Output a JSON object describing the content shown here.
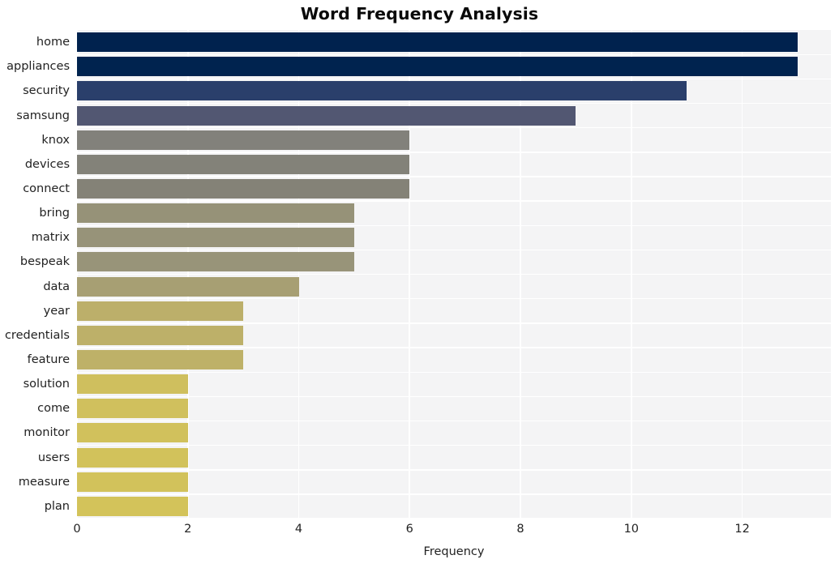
{
  "chart_data": {
    "type": "bar",
    "orientation": "horizontal",
    "title": "Word Frequency Analysis",
    "xlabel": "Frequency",
    "ylabel": "",
    "xlim": [
      0,
      13.6
    ],
    "ylim": [
      0,
      20
    ],
    "grid": true,
    "legend": null,
    "xticks": [
      0,
      2,
      4,
      6,
      8,
      10,
      12
    ],
    "xticklabels": [
      "0",
      "2",
      "4",
      "6",
      "8",
      "10",
      "12"
    ],
    "categories": [
      "home",
      "appliances",
      "security",
      "samsung",
      "knox",
      "devices",
      "connect",
      "bring",
      "matrix",
      "bespeak",
      "data",
      "year",
      "credentials",
      "feature",
      "solution",
      "come",
      "monitor",
      "users",
      "measure",
      "plan"
    ],
    "values": [
      13,
      13,
      11,
      9,
      6,
      6,
      6,
      5,
      5,
      5,
      4,
      3,
      3,
      3,
      2,
      2,
      2,
      2,
      2,
      2
    ],
    "colors": [
      "#00224e",
      "#00234f",
      "#2a3f6b",
      "#525772",
      "#82817b",
      "#838279",
      "#848277",
      "#969278",
      "#979379",
      "#989479",
      "#a79f73",
      "#bcaf6a",
      "#bdb069",
      "#beb168",
      "#cfbf5e",
      "#d0c05d",
      "#d1c15c",
      "#d2c25b",
      "#d2c25b",
      "#d3c35a"
    ],
    "colormap": "cividis",
    "plot_background": "#f4f4f5",
    "gridline_color": "#ffffff",
    "text_color": "#222222"
  }
}
